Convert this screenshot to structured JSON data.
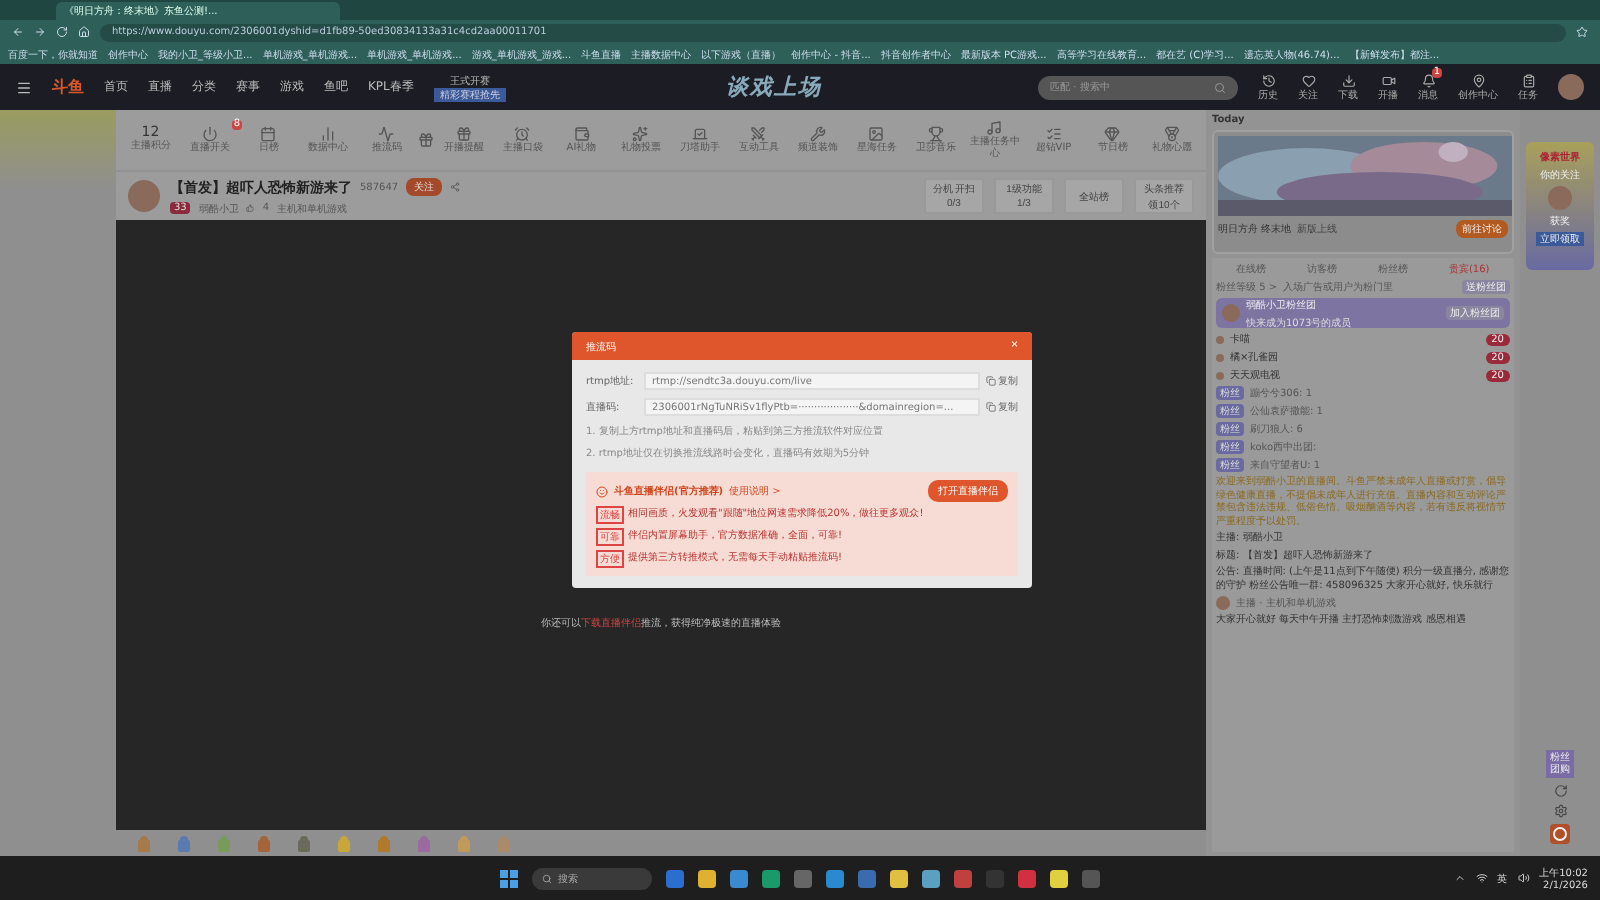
{
  "browser": {
    "tab_title": "《明日方舟：终末地》东鱼公测!...",
    "url": "https://www.douyu.com/2306001dyshid=d1fb89-50ed30834133a31c4cd2aa00011701",
    "bookmarks": [
      "百度一下，你就知道",
      "创作中心",
      "我的小卫_等级小卫...",
      "单机游戏_单机游戏...",
      "单机游戏_单机游戏...",
      "游戏_单机游戏_游戏...",
      "斗鱼直播",
      "主播数据中心",
      "以下游戏（直播）",
      "创作中心 - 抖音...",
      "抖音创作者中心",
      "最新版本 PC游戏...",
      "高等学习在线教育...",
      "都在艺 (C)学习...",
      "遗忘英人物(46.74)...",
      "【新鲜发布】都注..."
    ]
  },
  "site_header": {
    "logo": "斗鱼",
    "nav": [
      {
        "label": "首页",
        "selected": false
      },
      {
        "label": "直播",
        "selected": false
      },
      {
        "label": "分类",
        "selected": false
      },
      {
        "label": "赛事",
        "selected": false
      },
      {
        "label": "游戏",
        "selected": false
      },
      {
        "label": "鱼吧",
        "selected": false
      },
      {
        "label": "KPL春季",
        "selected": false
      }
    ],
    "promo_top": "王式开赛",
    "promo_bottom": "精彩赛程抢先",
    "banner": "谈戏上场",
    "search": {
      "placeholder": "匹配 · 搜索中"
    },
    "actions": [
      "历史",
      "关注",
      "下载",
      "开播",
      "消息",
      "创作中心",
      "任务"
    ],
    "message_badge": "1"
  },
  "toolbar": {
    "points": "12",
    "points_label": "主播积分",
    "tools": [
      "直播开关",
      "日榜",
      "数据中心",
      "推流码",
      "开播提醒",
      "主播口袋",
      "AI礼物",
      "礼物投票",
      "刀塔助手",
      "互动工具",
      "频道装饰",
      "星海任务",
      "卫莎音乐",
      "主播任务中心",
      "超钻VIP",
      "节日榜",
      "礼物心愿"
    ],
    "switch_badge": "8"
  },
  "room": {
    "title": "【首发】超吓人恐怖新游来了",
    "room_id": "587647",
    "follow": "关注",
    "level": "33",
    "streamer": "弱酷小卫",
    "likes": "4",
    "category": "主机和单机游戏",
    "stats": [
      {
        "top": "分机 开扫",
        "bottom": "0/3"
      },
      {
        "top": "1级功能",
        "bottom": "1/3"
      },
      {
        "top": "全站榜"
      },
      {
        "top": "头条推荐",
        "bottom": "领10个"
      }
    ]
  },
  "video": {
    "hint_before": "你还可以",
    "hint_link": "下载直播伴侣",
    "hint_after": "推流，获得纯净极速的直播体验"
  },
  "dialog": {
    "title": "推流码",
    "close": "×",
    "fields": [
      {
        "label": "rtmp地址:",
        "value": "rtmp://sendtc3a.douyu.com/live",
        "action": "复制"
      },
      {
        "label": "直播码:",
        "value": "2306001rNgTuNRiSv1flyPtb=···················&domainregion=...",
        "action": "复制"
      }
    ],
    "notes": [
      "1. 复制上方rtmp地址和直播码后，粘贴到第三方推流软件对应位置",
      "2. rtmp地址仅在切换推流线路时会变化，直播码有效期为5分钟"
    ],
    "promo": {
      "title": "斗鱼直播伴侣(官方推荐)",
      "link": "使用说明 >",
      "button": "打开直播伴侣",
      "features": [
        {
          "tag": "流畅",
          "text": "相同画质，火发观看\"跟随\"地位网速需求降低20%，做往更多观众!"
        },
        {
          "tag": "可靠",
          "text": "伴侣内置屏幕助手，官方数据准确，全面，可靠!"
        },
        {
          "tag": "方便",
          "text": "提供第三方转推模式，无需每天手动粘贴推流码!"
        }
      ]
    }
  },
  "sidebar": {
    "today": "Today",
    "card_name": "明日方舟 终末地",
    "card_tag": "新版上线",
    "card_button": "前往讨论",
    "tabs": [
      {
        "label": "在线榜",
        "selected": false
      },
      {
        "label": "访客榜",
        "selected": false
      },
      {
        "label": "粉丝榜",
        "selected": false
      },
      {
        "label": "贵宾(16)",
        "selected": true
      }
    ],
    "filter": "粉丝等级 5 >",
    "filter_hint": "入场广告或用户为粉门里",
    "filter_button": "送粉丝团",
    "banner_title": "弱酷小卫粉丝团",
    "banner_sub": "快来成为1073号的成员",
    "banner_button": "加入粉丝团",
    "rank": [
      {
        "name": "卡喵",
        "badge": "20"
      },
      {
        "name": "橘×孔雀园",
        "badge": "20"
      },
      {
        "name": "天天观电视",
        "badge": "20"
      }
    ],
    "chat": [
      {
        "badge": "粉丝",
        "text": "蹦兮兮306: 1"
      },
      {
        "badge": "粉丝",
        "text": "公仙袁萨撒能: 1"
      },
      {
        "badge": "粉丝",
        "text": "刷刀狼人: 6"
      },
      {
        "badge": "粉丝",
        "text": "koko西中出团:"
      },
      {
        "badge": "粉丝",
        "text": "来自守望者U: 1"
      }
    ],
    "system": "欢迎来到弱酷小卫的直播间。斗鱼严禁未成年人直播或打赏，倡导绿色健康直播，不提倡未成年人进行充值。直播内容和互动评论严禁包含违法违规、低俗色情、吸烟酗酒等内容，若有违反将视情节严重程度予以处罚。",
    "info": [
      {
        "tag": "主播:",
        "text": "弱酷小卫"
      },
      {
        "tag": "标题:",
        "text": "【首发】超吓人恐怖新游来了"
      },
      {
        "tag": "公告:",
        "text": "直播时间: (上午是11点到下午随便) 积分一级直播分, 感谢您的守护 粉丝公告唯一群: 458096325 大家开心就好, 快乐就行"
      }
    ],
    "anchor_tag": "主播 · 主机和单机游戏",
    "anchor_text": "大家开心就好 每天中午开播 主打恐怖刺激游戏 感恩相遇"
  },
  "rail": {
    "ad_title": "像素世界",
    "ad_label": "你的关注",
    "ad_name": "获奖",
    "ad_button": "立即领取",
    "tool": "粉丝团购"
  },
  "taskbar": {
    "search": "搜索",
    "lang": "英",
    "time": "上午10:02",
    "date": "2/1/2026"
  }
}
